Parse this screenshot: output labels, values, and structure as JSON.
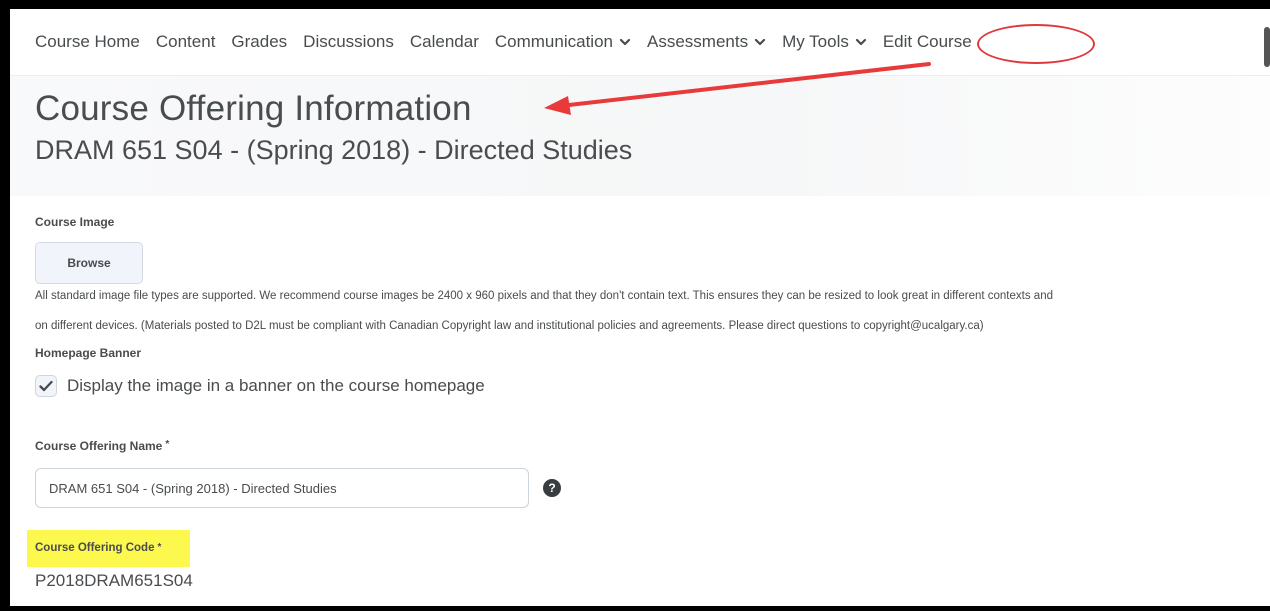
{
  "nav": {
    "items": [
      {
        "label": "Course Home",
        "dropdown": false
      },
      {
        "label": "Content",
        "dropdown": false
      },
      {
        "label": "Grades",
        "dropdown": false
      },
      {
        "label": "Discussions",
        "dropdown": false
      },
      {
        "label": "Calendar",
        "dropdown": false
      },
      {
        "label": "Communication",
        "dropdown": true
      },
      {
        "label": "Assessments",
        "dropdown": true
      },
      {
        "label": "My Tools",
        "dropdown": true
      },
      {
        "label": "Edit Course",
        "dropdown": false
      }
    ]
  },
  "page": {
    "title": "Course Offering Information",
    "subtitle": "DRAM 651 S04 - (Spring 2018) - Directed Studies"
  },
  "course_image": {
    "label": "Course Image",
    "browse_label": "Browse",
    "help_line1": "All standard image file types are supported. We recommend course images be 2400 x 960 pixels and that they don't contain text. This ensures they can be resized to look great in different contexts and",
    "help_line2": "on different devices. (Materials posted to D2L must be compliant with Canadian Copyright law and institutional policies and agreements. Please direct questions to copyright@ucalgary.ca)"
  },
  "homepage_banner": {
    "label": "Homepage Banner",
    "checkbox_label": "Display the image in a banner on the course homepage",
    "checked": true
  },
  "offering_name": {
    "label": "Course Offering Name",
    "required_mark": "*",
    "value": "DRAM 651 S04 - (Spring 2018) - Directed Studies",
    "help_icon": "question-circle-icon"
  },
  "offering_code": {
    "label": "Course Offering Code",
    "required_mark": "*",
    "value": "P2018DRAM651S04"
  },
  "annotations": {
    "circle_color": "#e03b3b",
    "arrow_color": "#e83a3a",
    "highlight_color": "#fcf84e"
  }
}
